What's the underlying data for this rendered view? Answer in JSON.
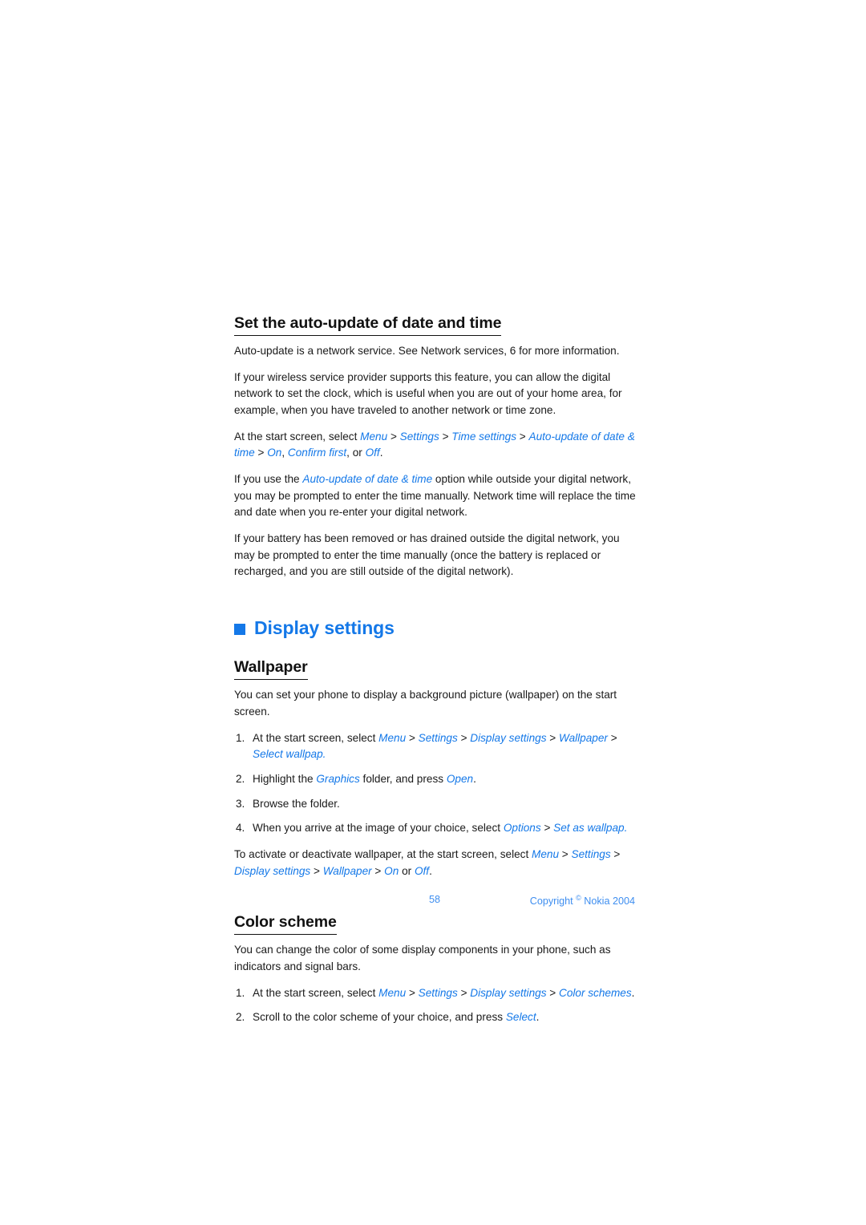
{
  "page": {
    "number": "58",
    "copyright_prefix": "Copyright",
    "copyright_symbol": "©",
    "copyright_suffix": "Nokia 2004",
    "accent_color": "#1478E8",
    "footer_color": "#3E8EF0",
    "text_color": "#1a1a1a",
    "background": "#ffffff"
  },
  "sections": {
    "auto_update": {
      "heading": "Set the auto-update of date and time",
      "p1": "Auto-update is a network service. See Network services, 6 for more information.",
      "p2": "If your wireless service provider supports this feature, you can allow the digital network to set the clock, which is useful when you are out of your home area, for example, when you have traveled to another network or time zone.",
      "p3_pre": "At the start screen, select ",
      "p3_menu": "Menu",
      "p3_settings": "Settings",
      "p3_time_settings": "Time settings",
      "p3_auto_update": "Auto-update of date & time",
      "p3_on": "On",
      "p3_confirm": "Confirm first",
      "p3_or": ", or ",
      "p3_off": "Off",
      "p3_comma": ", ",
      "p4_pre": "If you use the ",
      "p4_em": "Auto-update of date & time",
      "p4_post": " option while outside your digital network, you may be prompted to enter the time manually. Network time will replace the time and date when you re-enter your digital network.",
      "p5": "If your battery has been removed or has drained outside the digital network, you may be prompted to enter the time manually (once the battery is replaced or recharged, and you are still outside of the digital network)."
    },
    "display_settings": {
      "heading": "Display settings",
      "bullet_icon": "filled-square-icon"
    },
    "wallpaper": {
      "heading": "Wallpaper",
      "intro": "You can set your phone to display a background picture (wallpaper) on the start screen.",
      "steps": [
        {
          "num": "1.",
          "pre": "At the start screen, select ",
          "menu": "Menu",
          "settings": "Settings",
          "display_settings": "Display settings",
          "wallpaper": "Wallpaper",
          "select_wallpap": "Select wallpap."
        },
        {
          "num": "2.",
          "pre": "Highlight the ",
          "graphics": "Graphics",
          "mid": " folder, and press ",
          "open": "Open",
          "post": "."
        },
        {
          "num": "3.",
          "text": "Browse the folder."
        },
        {
          "num": "4.",
          "pre": "When you arrive at the image of your choice, select ",
          "options": "Options",
          "set_as_wallpap": "Set as wallpap."
        }
      ],
      "activate_pre": "To activate or deactivate wallpaper, at the start screen, select ",
      "activate_menu": "Menu",
      "activate_settings": "Settings",
      "activate_display_settings": "Display settings",
      "activate_wallpaper": "Wallpaper",
      "activate_on": "On",
      "activate_or": " or ",
      "activate_off": "Off",
      "activate_end": "."
    },
    "color_scheme": {
      "heading": "Color scheme",
      "intro": "You can change the color of some display components in your phone, such as indicators and signal bars.",
      "steps": [
        {
          "num": "1.",
          "pre": "At the start screen, select ",
          "menu": "Menu",
          "settings": "Settings",
          "display_settings": "Display settings",
          "color_schemes": "Color schemes",
          "post": "."
        },
        {
          "num": "2.",
          "pre": "Scroll to the color scheme of your choice, and press ",
          "select": "Select",
          "post": "."
        }
      ]
    }
  },
  "separators": {
    "gt": " > "
  }
}
